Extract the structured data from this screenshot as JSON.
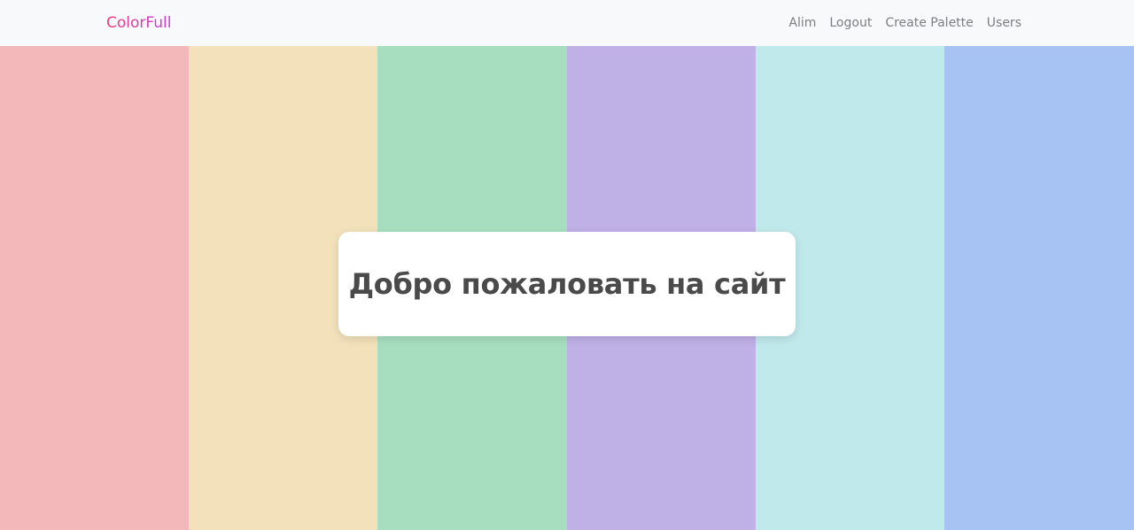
{
  "navbar": {
    "brand": "ColorFull",
    "links": [
      {
        "label": "Alim"
      },
      {
        "label": "Logout"
      },
      {
        "label": "Create Palette"
      },
      {
        "label": "Users"
      }
    ]
  },
  "palette": {
    "colors": [
      "#f2b8ba",
      "#f2e1bb",
      "#a8dec0",
      "#bfb0e6",
      "#c0e9eb",
      "#a6c3f4"
    ]
  },
  "welcome": {
    "title": "Добро пожаловать на сайт"
  }
}
